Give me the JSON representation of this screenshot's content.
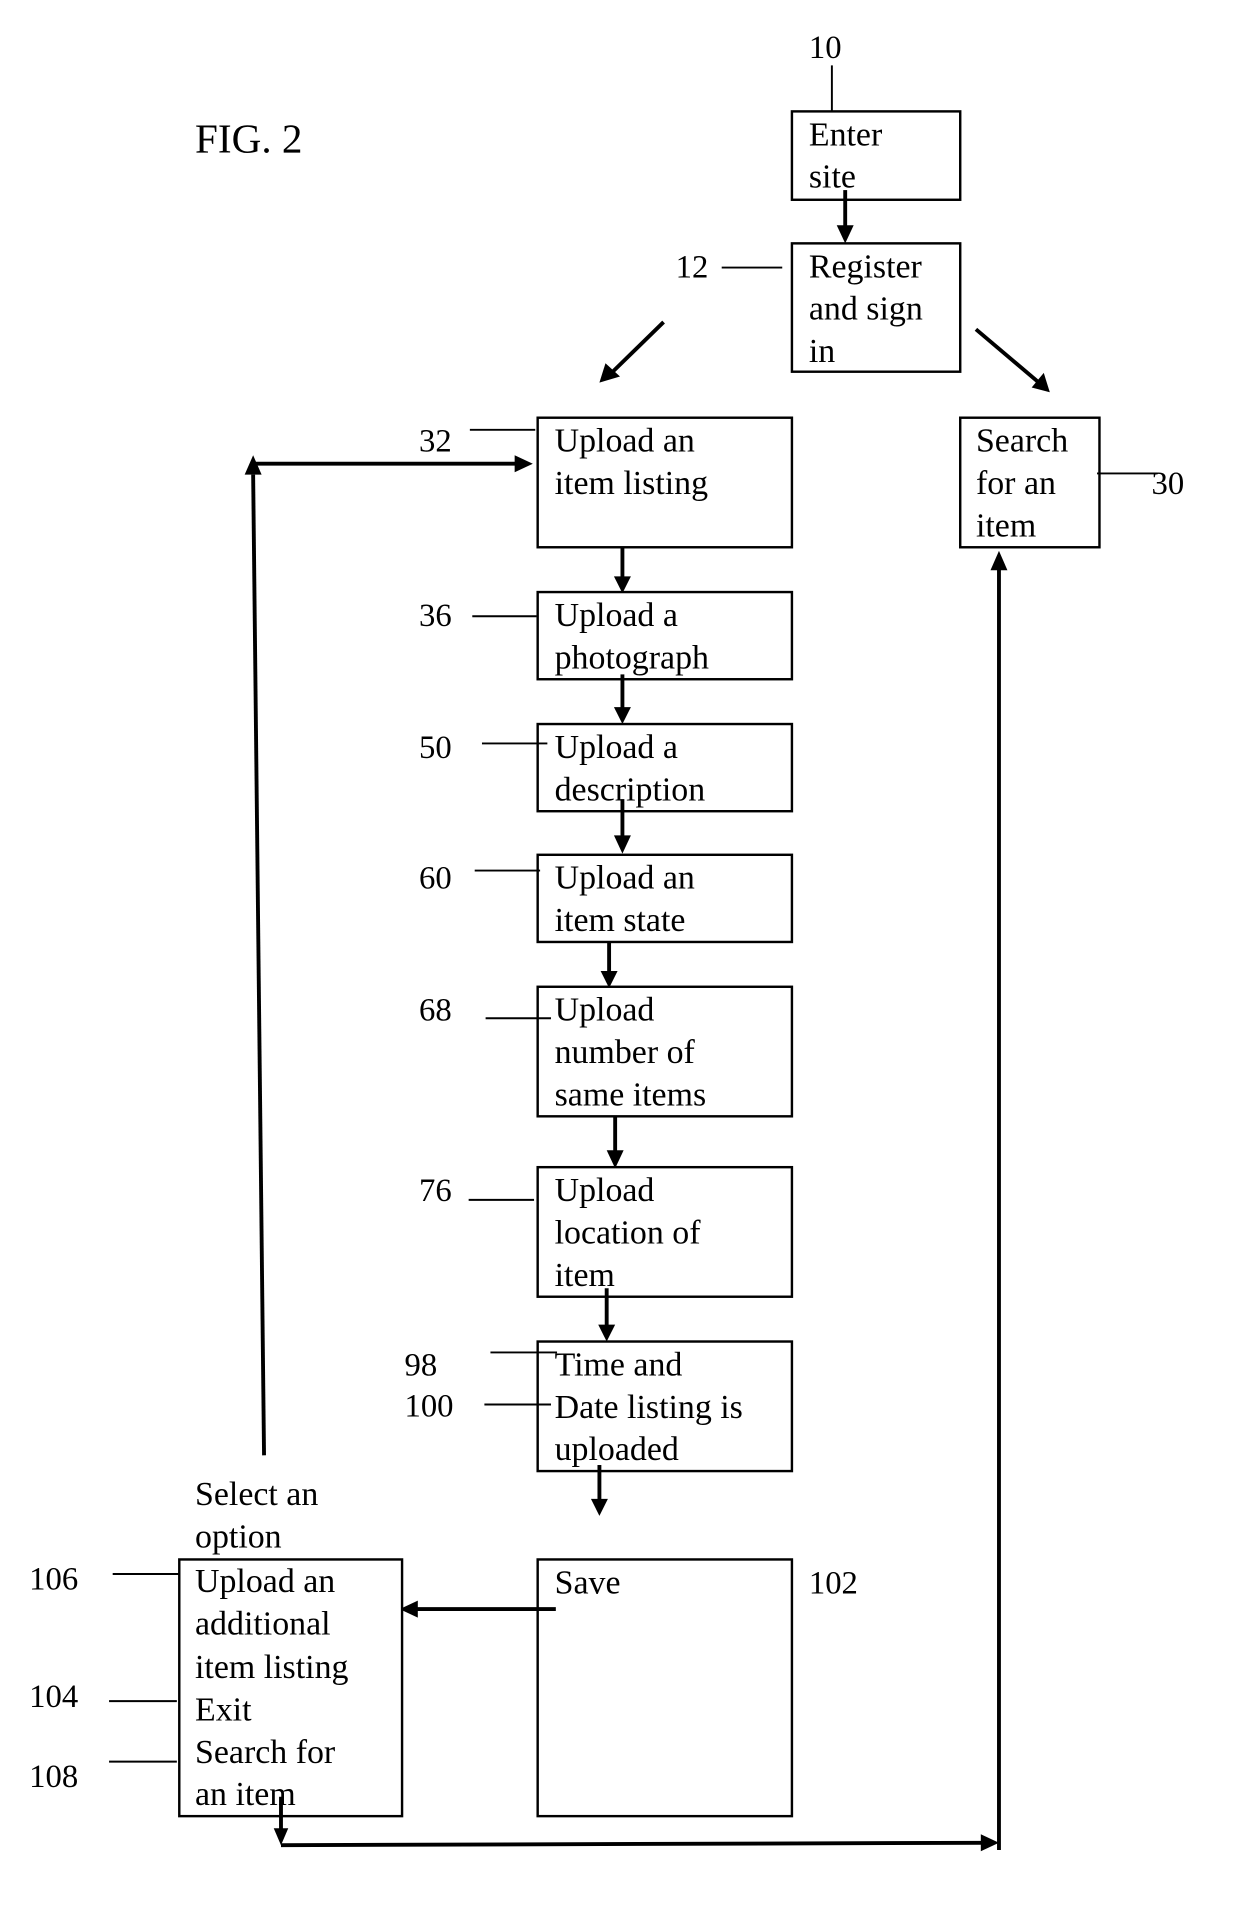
{
  "figure": {
    "title": "FIG. 2",
    "ink_color": "#000000",
    "background_color": "#ffffff"
  },
  "nodes": {
    "enter_site": {
      "ref": "10",
      "lines": [
        "Enter",
        "site"
      ]
    },
    "register": {
      "ref": "12",
      "lines": [
        "Register",
        "and sign",
        "in"
      ]
    },
    "upload_listing": {
      "ref": "32",
      "lines": [
        "Upload an",
        "item listing"
      ]
    },
    "search_item": {
      "ref": "30",
      "lines": [
        "Search",
        "for an",
        "item"
      ]
    },
    "upload_photo": {
      "ref": "36",
      "lines": [
        "Upload a",
        "photograph"
      ]
    },
    "upload_description": {
      "ref": "50",
      "lines": [
        "Upload a",
        "description"
      ]
    },
    "upload_state": {
      "ref": "60",
      "lines": [
        "Upload an",
        "item state"
      ]
    },
    "upload_quantity": {
      "ref": "68",
      "lines": [
        "Upload",
        "number of",
        "same items"
      ]
    },
    "upload_location": {
      "ref": "76",
      "lines": [
        "Upload",
        "location of",
        "item"
      ]
    },
    "time_date": {
      "refs": [
        "98",
        "100"
      ],
      "lines": [
        "Time and",
        "Date listing is",
        "uploaded"
      ]
    },
    "save": {
      "ref": "102",
      "lines": [
        "Save"
      ]
    },
    "options": {
      "heading": [
        "Select an",
        "option"
      ],
      "items": [
        {
          "ref": "106",
          "lines": [
            "Upload an",
            "additional",
            "item listing"
          ]
        },
        {
          "ref": "104",
          "lines": [
            "Exit"
          ]
        },
        {
          "ref": "108",
          "lines": [
            "Search for",
            "an item"
          ]
        }
      ]
    }
  }
}
